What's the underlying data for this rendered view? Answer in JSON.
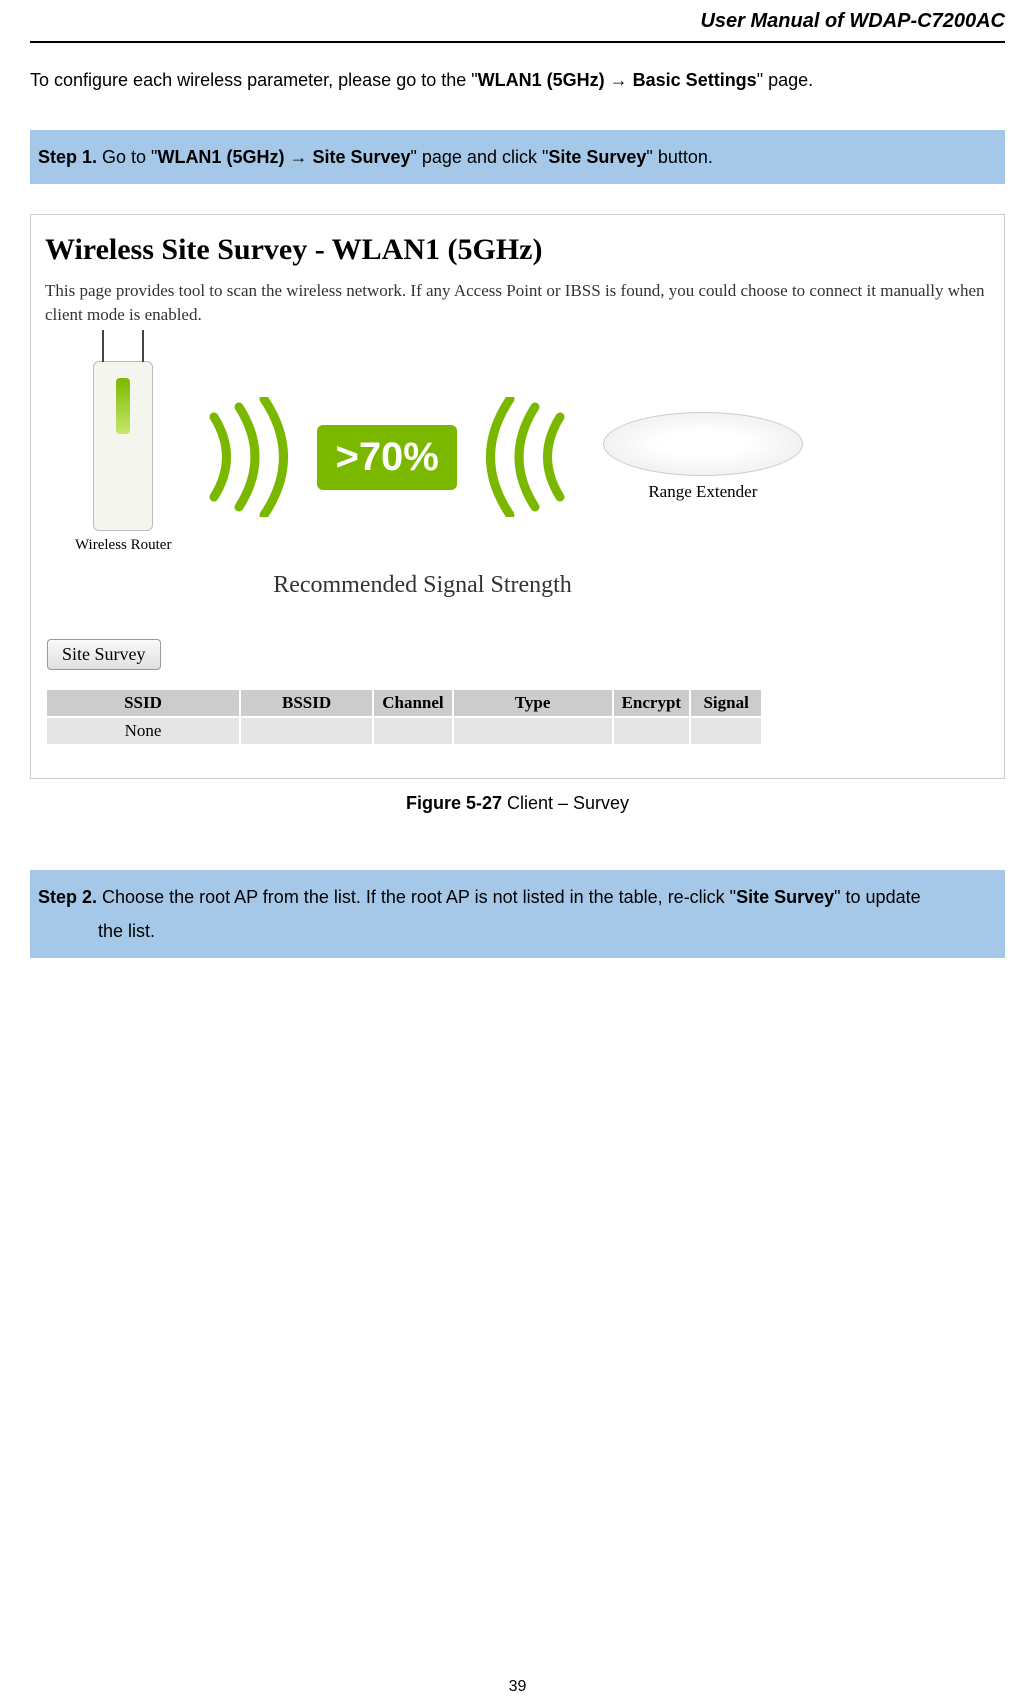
{
  "header": {
    "title": "User Manual of WDAP-C7200AC"
  },
  "intro": {
    "prefix": "To configure each wireless parameter, please go to the \"",
    "bold1": "WLAN1 (5GHz) → Basic Settings",
    "suffix": "\" page."
  },
  "step1": {
    "label": "Step 1.",
    "t1": "   Go to \"",
    "bold1": "WLAN1 (5GHz) → Site Survey",
    "t2": "\" page and click \"",
    "bold2": "Site Survey",
    "t3": "\" button."
  },
  "figure": {
    "title": "Wireless Site Survey - WLAN1 (5GHz)",
    "desc": "This page provides tool to scan the wireless network. If any Access Point or IBSS is found, you could choose to connect it manually when client mode is enabled.",
    "pct": ">70%",
    "router_label": "Wireless Router",
    "extender_label": "Range Extender",
    "rec_label": "Recommended Signal Strength",
    "button_label": "Site Survey",
    "columns": {
      "ssid": "SSID",
      "bssid": "BSSID",
      "channel": "Channel",
      "type": "Type",
      "encrypt": "Encrypt",
      "signal": "Signal"
    },
    "row_none": "None"
  },
  "caption": {
    "bold": "Figure 5-27",
    "rest": " Client – Survey"
  },
  "step2": {
    "label": "Step 2.",
    "t1": " Choose the root AP from the list. If the root AP is not listed in the table, re-click \"",
    "bold1": "Site Survey",
    "t2": "\" to update",
    "t3": "the list."
  },
  "page_number": "39"
}
